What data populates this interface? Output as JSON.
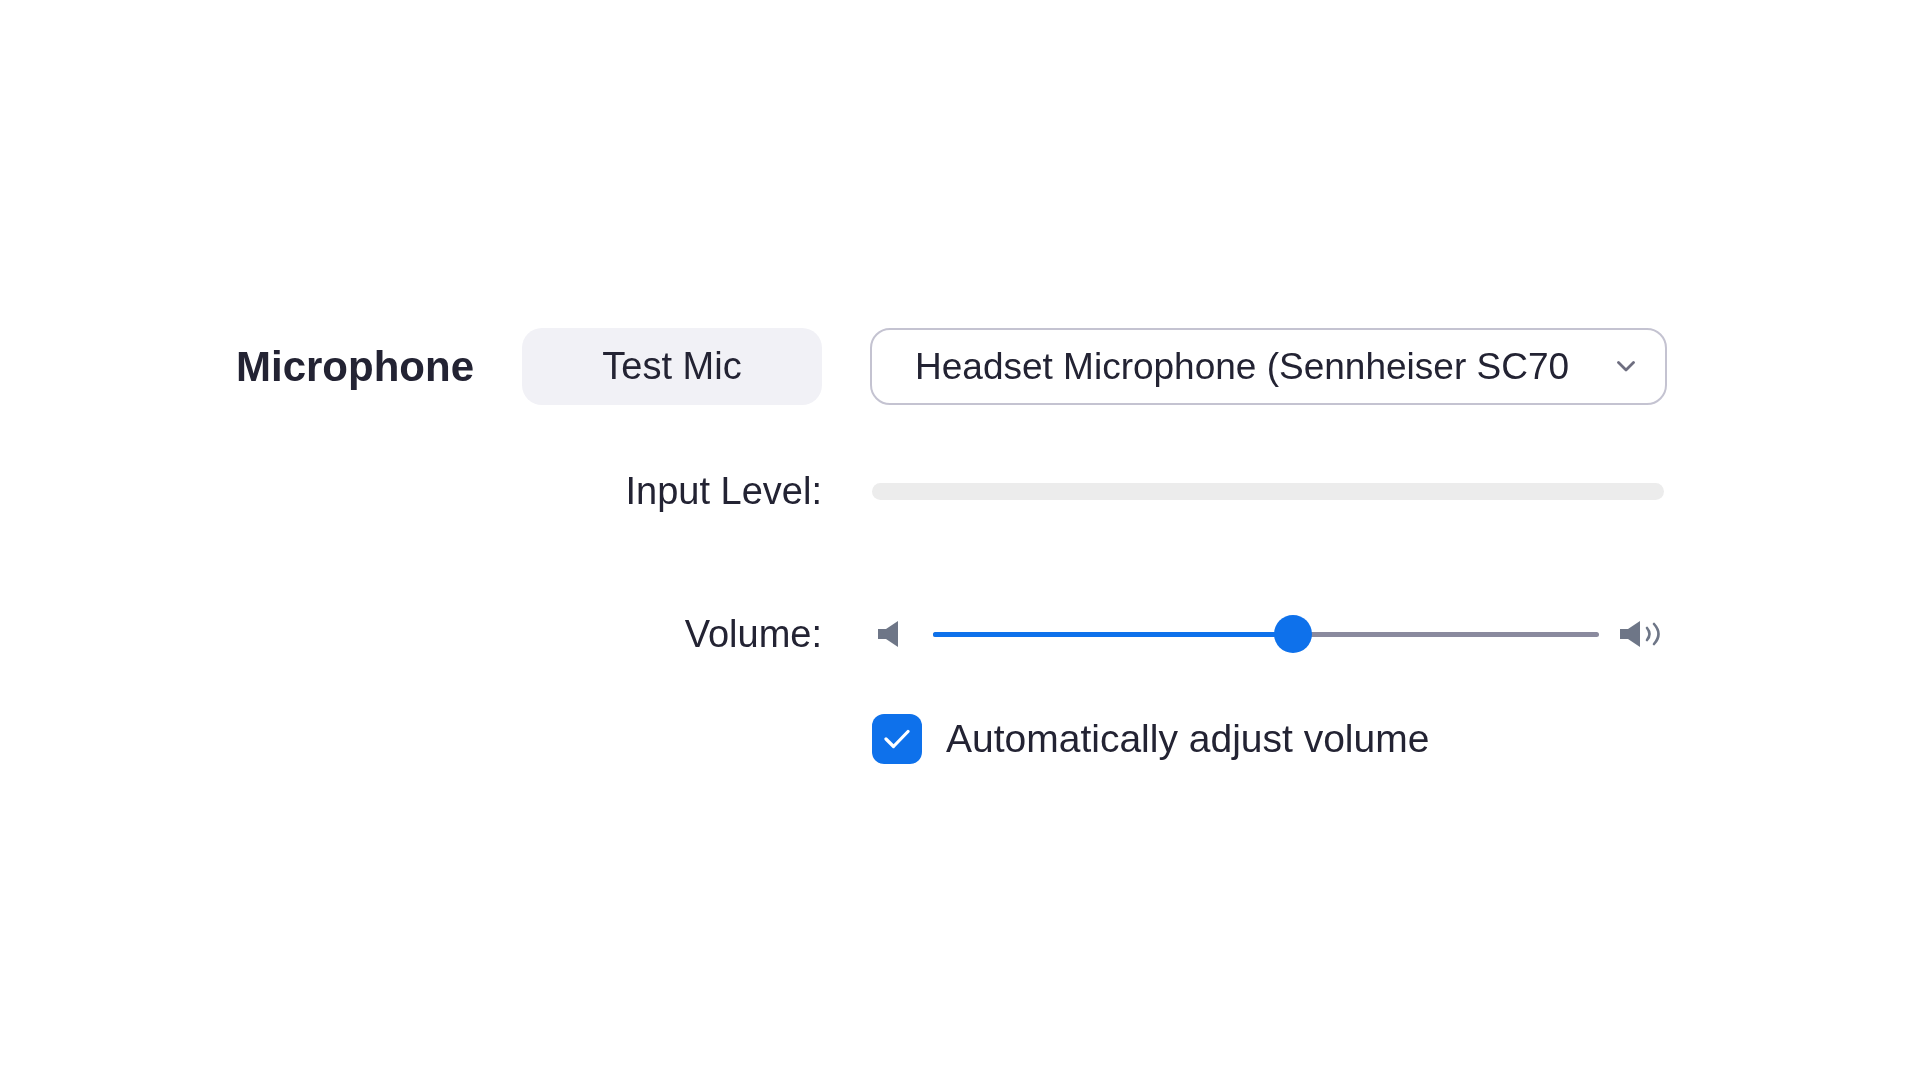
{
  "section": {
    "title": "Microphone"
  },
  "test_button": {
    "label": "Test Mic"
  },
  "device_dropdown": {
    "value": "Headset Microphone (Sennheiser SC70"
  },
  "input_level": {
    "label": "Input Level:"
  },
  "volume": {
    "label": "Volume:",
    "level": 0.54
  },
  "auto_adjust": {
    "label": "Automatically adjust volume",
    "checked": true
  }
}
